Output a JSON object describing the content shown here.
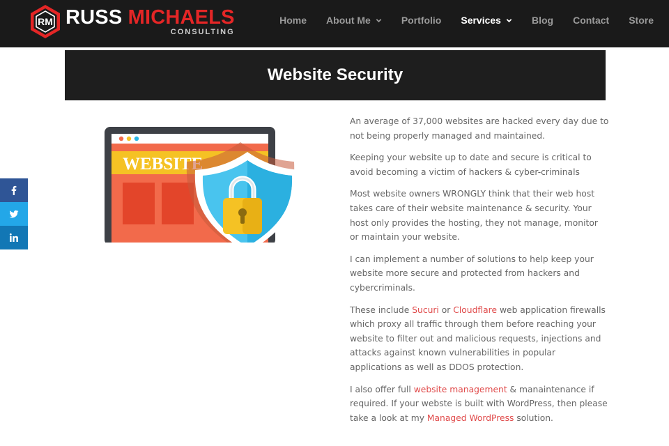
{
  "logo": {
    "word1": "RUSS",
    "word2": "MICHAELS",
    "sub": "CONSULTING",
    "monogram": "RM"
  },
  "nav": {
    "items": [
      {
        "label": "Home",
        "dropdown": false,
        "active": false
      },
      {
        "label": "About Me",
        "dropdown": true,
        "active": false
      },
      {
        "label": "Portfolio",
        "dropdown": false,
        "active": false
      },
      {
        "label": "Services",
        "dropdown": true,
        "active": true
      },
      {
        "label": "Blog",
        "dropdown": false,
        "active": false
      },
      {
        "label": "Contact",
        "dropdown": false,
        "active": false
      },
      {
        "label": "Store",
        "dropdown": false,
        "active": false
      }
    ]
  },
  "page": {
    "title": "Website Security"
  },
  "illustration": {
    "label": "WEBSITE"
  },
  "social": {
    "icons": [
      "facebook-icon",
      "twitter-icon",
      "linkedin-icon"
    ]
  },
  "content": {
    "p1": "An average of 37,000 websites are hacked every day due to not being properly managed and maintained.",
    "p2": "Keeping your website up to date and secure is critical to avoid becoming a victim of hackers & cyber-criminals",
    "p3": "Most website owners WRONGLY think that their web host takes care of their website maintenance & security. Your host only provides the hosting, they not manage, monitor or maintain your website.",
    "p4": "I can implement a number of solutions to  help keep your website more secure and protected from hackers and cybercriminals.",
    "p5": {
      "before": "These include ",
      "link1": "Sucuri",
      "mid": " or ",
      "link2": "Cloudflare",
      "after": " web application firewalls which proxy all traffic through them before reaching your website to filter out and malicious requests, injections and attacks against known vulnerabilities in popular applications as well as DDOS protection."
    },
    "p6": {
      "before": "I also offer full ",
      "link1": "website management",
      "mid": " & manaintenance if required. If your webste is built with WordPress, then  please take a look at my ",
      "link2": "Managed WordPress",
      "after": " solution."
    }
  },
  "colors": {
    "header_bg": "#1a1a1a",
    "brand_red": "#e42626",
    "link": "#e04a4a",
    "facebook": "#2f5596",
    "twitter": "#23a7e8",
    "linkedin": "#1277b5"
  }
}
